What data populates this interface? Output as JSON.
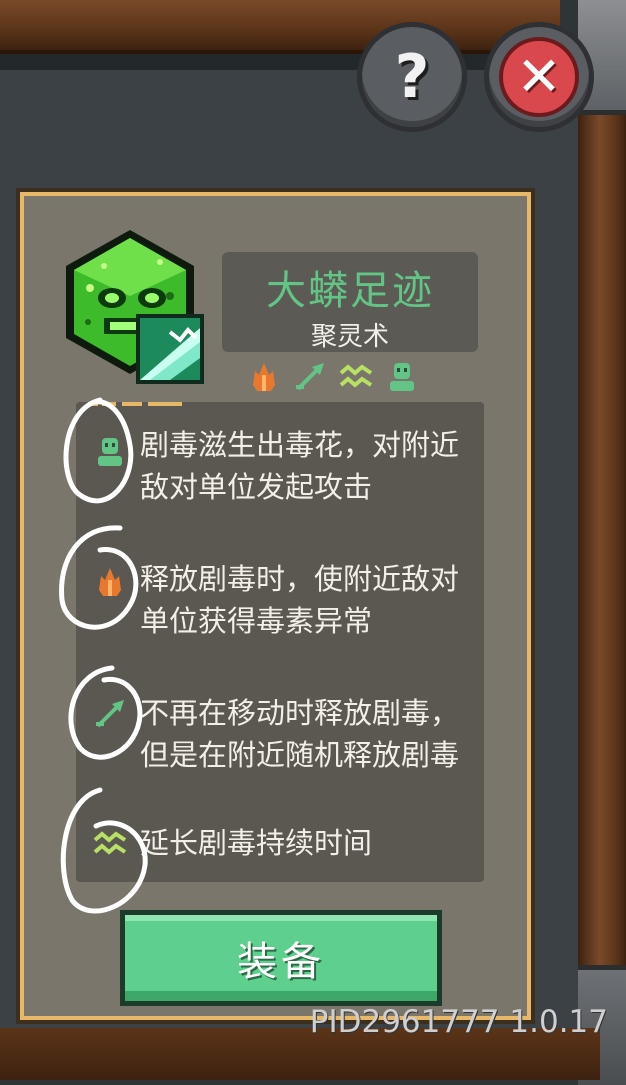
{
  "header": {
    "help_icon": "question-mark-icon",
    "close_icon": "close-x-icon",
    "help_symbol": "?",
    "close_symbol": "✕"
  },
  "skill": {
    "name": "大蟒足迹",
    "school": "聚灵术",
    "icon": "green-serpent-face-icon",
    "sub_icon": "wind-slash-icon",
    "tags": [
      "flame-icon",
      "arrow-icon",
      "wave-icon",
      "spirit-icon"
    ]
  },
  "effects": [
    {
      "icon": "spirit-icon",
      "text": "剧毒滋生出毒花，对附近敌对单位发起攻击"
    },
    {
      "icon": "flame-icon",
      "text": "释放剧毒时，使附近敌对单位获得毒素异常"
    },
    {
      "icon": "arrow-icon",
      "text": "不再在移动时释放剧毒，但是在附近随机释放剧毒"
    },
    {
      "icon": "wave-icon",
      "text": "延长剧毒持续时间"
    }
  ],
  "equip_button": {
    "label": "装备"
  },
  "footer": {
    "version": "PID2961777 1.0.17"
  },
  "colors": {
    "panel": "#7a766c",
    "panel_border": "#e7b867",
    "title_green": "#62c485",
    "button_green": "#5fcf8d",
    "close_red": "#d9484c"
  }
}
